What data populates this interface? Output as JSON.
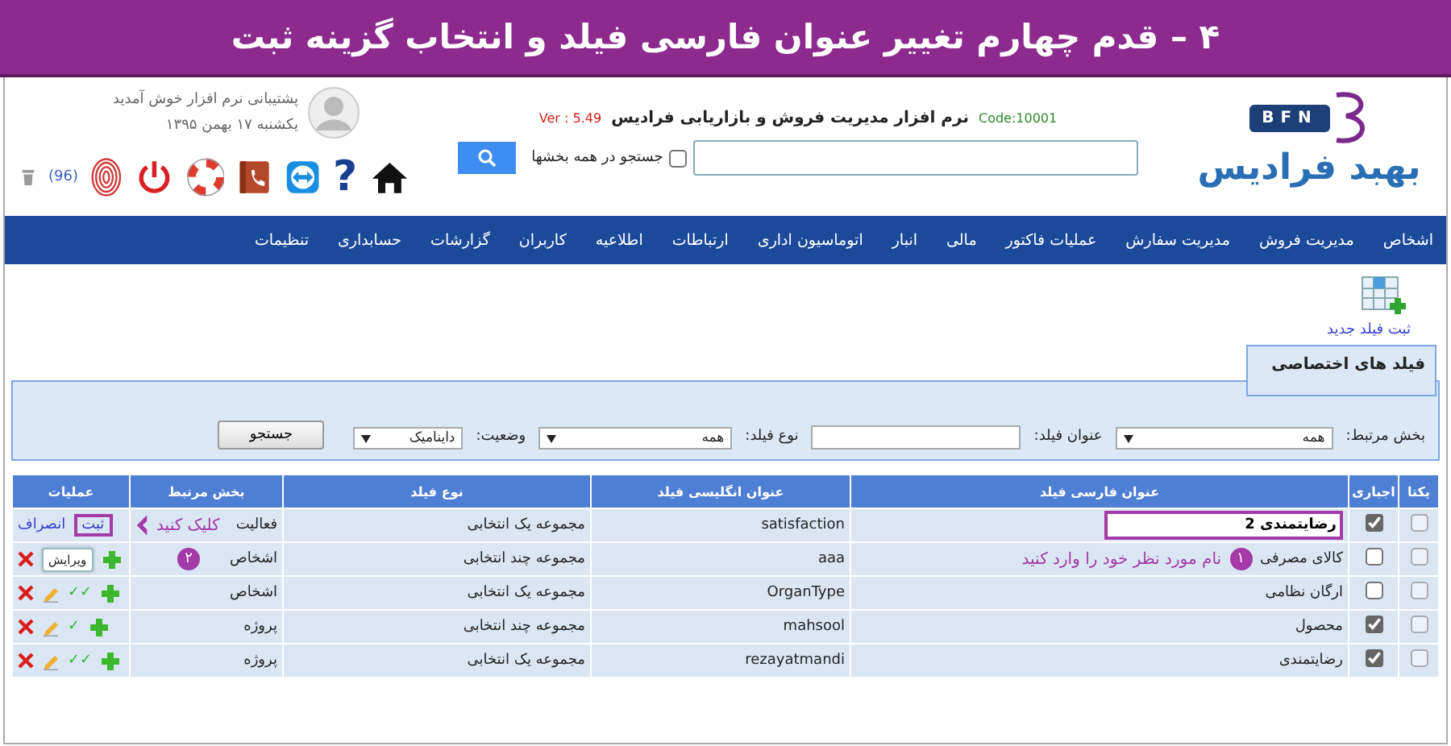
{
  "banner": {
    "title": "۴ – قدم چهارم تغییر عنوان فارسی فیلد و انتخاب گزینه ثبت"
  },
  "header": {
    "logo_text": "بهبد فرادیس",
    "logo_badge": "BFN",
    "app_title": "نرم افزار مدیریت فروش و بازاریابی فرادیس",
    "code": "Code:10001",
    "version": "Ver : 5.49",
    "search_all_label": "جستجو در همه بخشها",
    "search_all_checked": false,
    "welcome": "پشتیبانی نرم افزار خوش آمدید",
    "date": "یکشنبه ۱۷ بهمن ۱۳۹۵",
    "help": "?",
    "trash_count": "(96)"
  },
  "nav": [
    "اشخاص",
    "مدیریت فروش",
    "مدیریت سفارش",
    "عملیات فاکتور",
    "مالی",
    "انبار",
    "اتوماسیون اداری",
    "ارتباطات",
    "اطلاعیه",
    "کاربران",
    "گزارشات",
    "حسابداری",
    "تنظیمات"
  ],
  "new_field_link": "ثبت فیلد جدید",
  "panel": {
    "title": "فیلد های اختصاصی",
    "filters": [
      {
        "kind": "select",
        "label": "بخش مرتبط:",
        "value": "همه"
      },
      {
        "kind": "input",
        "label": "عنوان فیلد:"
      },
      {
        "kind": "select",
        "label": "نوع فیلد:",
        "value": "همه"
      },
      {
        "kind": "select",
        "label": "وضعیت:",
        "value": "داینامیک"
      }
    ],
    "search_button": "جستجو"
  },
  "table": {
    "columns": [
      "یکتا",
      "اجباری",
      "عنوان فارسی فیلد",
      "عنوان انگلیسی فیلد",
      "نوع فیلد",
      "بخش مرتبط",
      "عملیات"
    ],
    "rows": [
      {
        "unique": false,
        "required": true,
        "title": "رضایتمندی 2",
        "editing": true,
        "english": "satisfaction",
        "type": "مجموعه یک انتخابی",
        "section": "فعالیت",
        "section_callout": "کلیک کنید",
        "actions": {
          "kind": "edit",
          "save": "ثبت",
          "cancel": "انصراف"
        }
      },
      {
        "unique": false,
        "required": false,
        "title": "کالای مصرفی",
        "editing": false,
        "title_note": {
          "badge": "۱",
          "text": "نام مورد نظر خود را وارد کنید"
        },
        "english": "aaa",
        "type": "مجموعه چند انتخابی",
        "section": "اشخاص",
        "section_badge": "۲",
        "actions": {
          "kind": "icons",
          "tooltip": "ویرایش"
        }
      },
      {
        "unique": false,
        "required": false,
        "title": "ارگان نظامی",
        "editing": false,
        "english": "OrganType",
        "type": "مجموعه یک انتخابی",
        "section": "اشخاص",
        "actions": {
          "kind": "icons",
          "checks": "✓✓"
        }
      },
      {
        "unique": false,
        "required": true,
        "title": "محصول",
        "editing": false,
        "english": "mahsool",
        "type": "مجموعه چند انتخابی",
        "section": "پروژه",
        "actions": {
          "kind": "icons",
          "checks": "✓"
        }
      },
      {
        "unique": false,
        "required": true,
        "title": "رضایتمندی",
        "editing": false,
        "english": "rezayatmandi",
        "type": "مجموعه یک انتخابی",
        "section": "پروژه",
        "actions": {
          "kind": "icons",
          "checks": "✓✓"
        }
      }
    ]
  }
}
